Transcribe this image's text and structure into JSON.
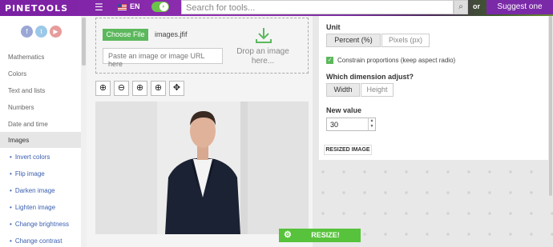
{
  "header": {
    "logo": "PINETOOLS",
    "language": "EN",
    "search_placeholder": "Search for tools...",
    "or_label": "or",
    "suggest_label": "Suggest one"
  },
  "sidebar": {
    "categories": [
      "Mathematics",
      "Colors",
      "Text and lists",
      "Numbers",
      "Date and time",
      "Images"
    ],
    "active_category": "Images",
    "subitems": [
      "Invert colors",
      "Flip image",
      "Darken image",
      "Lighten image",
      "Change brightness",
      "Change contrast"
    ]
  },
  "upload": {
    "choose_label": "Choose File",
    "file_name": "images.jfif",
    "paste_placeholder": "Paste an image or image URL here",
    "drop_text": "Drop an image here..."
  },
  "options": {
    "unit_label": "Unit",
    "unit_options": [
      "Percent (%)",
      "Pixels (px)"
    ],
    "unit_selected": "Percent (%)",
    "constrain_label": "Constrain proportions (keep aspect radio)",
    "constrain_checked": true,
    "dimension_label": "Which dimension adjust?",
    "dimension_options": [
      "Width",
      "Height"
    ],
    "dimension_selected": "Width",
    "new_value_label": "New value",
    "new_value": "30"
  },
  "result": {
    "resized_label": "RESIZED IMAGE",
    "resize_button": "RESIZE!"
  },
  "colors": {
    "accent_green": "#5cb85c",
    "header_purple": "#7a1fa2",
    "link_blue": "#3a5fb0"
  }
}
